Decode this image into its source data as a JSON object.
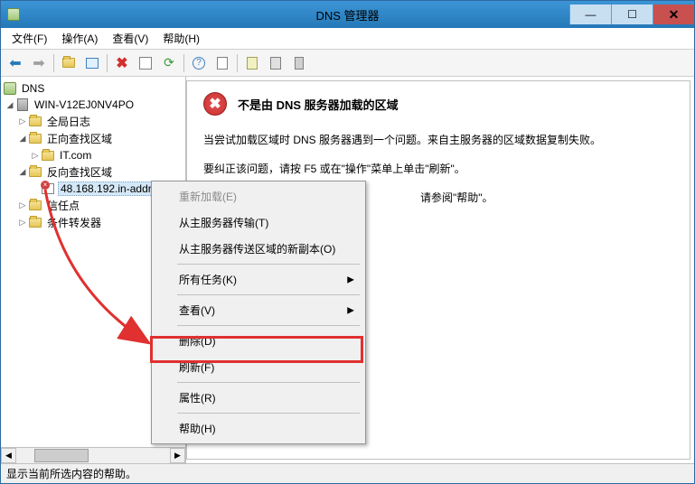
{
  "window": {
    "title": "DNS 管理器"
  },
  "menubar": {
    "file": "文件(F)",
    "action": "操作(A)",
    "view": "查看(V)",
    "help": "帮助(H)"
  },
  "tree": {
    "root": "DNS",
    "server": "WIN-V12EJ0NV4PO",
    "global_logs": "全局日志",
    "fwd_zones": "正向查找区域",
    "fwd_zone1": "IT.com",
    "rev_zones": "反向查找区域",
    "rev_zone1": "48.168.192.in-addr",
    "trust_points": "信任点",
    "cond_fwd": "条件转发器"
  },
  "detail": {
    "error_title": "不是由 DNS 服务器加载的区域",
    "line1": "当尝试加载区域时 DNS 服务器遇到一个问题。来自主服务器的区域数据复制失败。",
    "line2": "要纠正该问题，请按 F5 或在\"操作\"菜单上单击\"刷新\"。",
    "line3_partial": "请参阅\"帮助\"。"
  },
  "context_menu": {
    "reload": "重新加载(E)",
    "transfer": "从主服务器传输(T)",
    "new_copy": "从主服务器传送区域的新副本(O)",
    "all_tasks": "所有任务(K)",
    "view": "查看(V)",
    "delete": "删除(D)",
    "refresh": "刷新(F)",
    "properties": "属性(R)",
    "help": "帮助(H)"
  },
  "statusbar": {
    "text": "显示当前所选内容的帮助。"
  }
}
